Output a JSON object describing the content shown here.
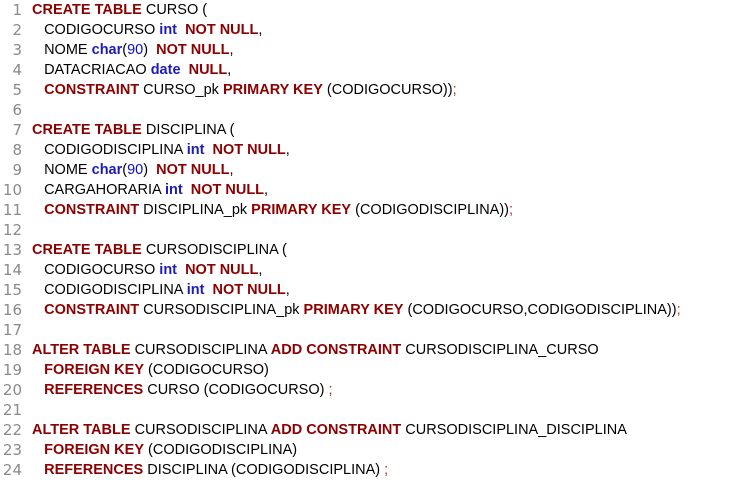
{
  "editor": {
    "colors": {
      "keyword": "#8b0000",
      "type": "#1c1cb8",
      "number": "#0b0bc9",
      "punctuation": "#c2272d",
      "identifier": "#000000",
      "line_number": "#8a8a8a"
    },
    "lines": [
      {
        "n": "1",
        "tokens": [
          {
            "t": "CREATE TABLE",
            "k": "kw"
          },
          {
            "t": " CURSO (",
            "k": "ident"
          }
        ]
      },
      {
        "n": "2",
        "tokens": [
          {
            "t": "   CODIGOCURSO ",
            "k": "ident"
          },
          {
            "t": "int",
            "k": "type"
          },
          {
            "t": "  ",
            "k": "ident"
          },
          {
            "t": "NOT NULL",
            "k": "kw"
          },
          {
            "t": ",",
            "k": "ident"
          }
        ]
      },
      {
        "n": "3",
        "tokens": [
          {
            "t": "   NOME ",
            "k": "ident"
          },
          {
            "t": "char",
            "k": "type"
          },
          {
            "t": "(",
            "k": "ident"
          },
          {
            "t": "90",
            "k": "num"
          },
          {
            "t": ")  ",
            "k": "ident"
          },
          {
            "t": "NOT NULL",
            "k": "kw"
          },
          {
            "t": ",",
            "k": "ident"
          }
        ]
      },
      {
        "n": "4",
        "tokens": [
          {
            "t": "   DATACRIACAO ",
            "k": "ident"
          },
          {
            "t": "date",
            "k": "type"
          },
          {
            "t": "  ",
            "k": "ident"
          },
          {
            "t": "NULL",
            "k": "kw"
          },
          {
            "t": ",",
            "k": "ident"
          }
        ]
      },
      {
        "n": "5",
        "tokens": [
          {
            "t": "   ",
            "k": "ident"
          },
          {
            "t": "CONSTRAINT",
            "k": "kw"
          },
          {
            "t": " CURSO_pk ",
            "k": "ident"
          },
          {
            "t": "PRIMARY KEY",
            "k": "kw"
          },
          {
            "t": " (CODIGOCURSO))",
            "k": "ident"
          },
          {
            "t": ";",
            "k": "punct"
          }
        ]
      },
      {
        "n": "6",
        "tokens": []
      },
      {
        "n": "7",
        "tokens": [
          {
            "t": "CREATE TABLE",
            "k": "kw"
          },
          {
            "t": " DISCIPLINA (",
            "k": "ident"
          }
        ]
      },
      {
        "n": "8",
        "tokens": [
          {
            "t": "   CODIGODISCIPLINA ",
            "k": "ident"
          },
          {
            "t": "int",
            "k": "type"
          },
          {
            "t": "  ",
            "k": "ident"
          },
          {
            "t": "NOT NULL",
            "k": "kw"
          },
          {
            "t": ",",
            "k": "ident"
          }
        ]
      },
      {
        "n": "9",
        "tokens": [
          {
            "t": "   NOME ",
            "k": "ident"
          },
          {
            "t": "char",
            "k": "type"
          },
          {
            "t": "(",
            "k": "ident"
          },
          {
            "t": "90",
            "k": "num"
          },
          {
            "t": ")  ",
            "k": "ident"
          },
          {
            "t": "NOT NULL",
            "k": "kw"
          },
          {
            "t": ",",
            "k": "ident"
          }
        ]
      },
      {
        "n": "10",
        "tokens": [
          {
            "t": "   CARGAHORARIA ",
            "k": "ident"
          },
          {
            "t": "int",
            "k": "type"
          },
          {
            "t": "  ",
            "k": "ident"
          },
          {
            "t": "NOT NULL",
            "k": "kw"
          },
          {
            "t": ",",
            "k": "ident"
          }
        ]
      },
      {
        "n": "11",
        "tokens": [
          {
            "t": "   ",
            "k": "ident"
          },
          {
            "t": "CONSTRAINT",
            "k": "kw"
          },
          {
            "t": " DISCIPLINA_pk ",
            "k": "ident"
          },
          {
            "t": "PRIMARY KEY",
            "k": "kw"
          },
          {
            "t": " (CODIGODISCIPLINA))",
            "k": "ident"
          },
          {
            "t": ";",
            "k": "punct"
          }
        ]
      },
      {
        "n": "12",
        "tokens": []
      },
      {
        "n": "13",
        "tokens": [
          {
            "t": "CREATE TABLE",
            "k": "kw"
          },
          {
            "t": " CURSODISCIPLINA (",
            "k": "ident"
          }
        ]
      },
      {
        "n": "14",
        "tokens": [
          {
            "t": "   CODIGOCURSO ",
            "k": "ident"
          },
          {
            "t": "int",
            "k": "type"
          },
          {
            "t": "  ",
            "k": "ident"
          },
          {
            "t": "NOT NULL",
            "k": "kw"
          },
          {
            "t": ",",
            "k": "ident"
          }
        ]
      },
      {
        "n": "15",
        "tokens": [
          {
            "t": "   CODIGODISCIPLINA ",
            "k": "ident"
          },
          {
            "t": "int",
            "k": "type"
          },
          {
            "t": "  ",
            "k": "ident"
          },
          {
            "t": "NOT NULL",
            "k": "kw"
          },
          {
            "t": ",",
            "k": "ident"
          }
        ]
      },
      {
        "n": "16",
        "tokens": [
          {
            "t": "   ",
            "k": "ident"
          },
          {
            "t": "CONSTRAINT",
            "k": "kw"
          },
          {
            "t": " CURSODISCIPLINA_pk ",
            "k": "ident"
          },
          {
            "t": "PRIMARY KEY",
            "k": "kw"
          },
          {
            "t": " (CODIGOCURSO,CODIGODISCIPLINA))",
            "k": "ident"
          },
          {
            "t": ";",
            "k": "punct"
          }
        ]
      },
      {
        "n": "17",
        "tokens": []
      },
      {
        "n": "18",
        "tokens": [
          {
            "t": "ALTER TABLE",
            "k": "kw"
          },
          {
            "t": " CURSODISCIPLINA ",
            "k": "ident"
          },
          {
            "t": "ADD CONSTRAINT",
            "k": "kw"
          },
          {
            "t": " CURSODISCIPLINA_CURSO",
            "k": "ident"
          }
        ]
      },
      {
        "n": "19",
        "tokens": [
          {
            "t": "   ",
            "k": "ident"
          },
          {
            "t": "FOREIGN KEY",
            "k": "kw"
          },
          {
            "t": " (CODIGOCURSO)",
            "k": "ident"
          }
        ]
      },
      {
        "n": "20",
        "tokens": [
          {
            "t": "   ",
            "k": "ident"
          },
          {
            "t": "REFERENCES",
            "k": "kw"
          },
          {
            "t": " CURSO (CODIGOCURSO) ",
            "k": "ident"
          },
          {
            "t": ";",
            "k": "punct"
          }
        ]
      },
      {
        "n": "21",
        "tokens": []
      },
      {
        "n": "22",
        "tokens": [
          {
            "t": "ALTER TABLE",
            "k": "kw"
          },
          {
            "t": " CURSODISCIPLINA ",
            "k": "ident"
          },
          {
            "t": "ADD CONSTRAINT",
            "k": "kw"
          },
          {
            "t": " CURSODISCIPLINA_DISCIPLINA",
            "k": "ident"
          }
        ]
      },
      {
        "n": "23",
        "tokens": [
          {
            "t": "   ",
            "k": "ident"
          },
          {
            "t": "FOREIGN KEY",
            "k": "kw"
          },
          {
            "t": " (CODIGODISCIPLINA)",
            "k": "ident"
          }
        ]
      },
      {
        "n": "24",
        "tokens": [
          {
            "t": "   ",
            "k": "ident"
          },
          {
            "t": "REFERENCES",
            "k": "kw"
          },
          {
            "t": " DISCIPLINA (CODIGODISCIPLINA) ",
            "k": "ident"
          },
          {
            "t": ";",
            "k": "punct"
          }
        ]
      }
    ]
  }
}
